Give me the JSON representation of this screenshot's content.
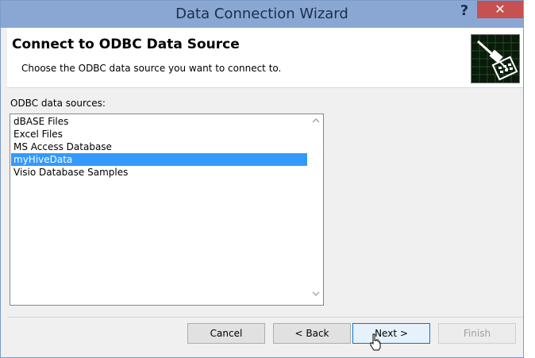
{
  "window": {
    "title": "Data Connection Wizard",
    "help_label": "?",
    "close_label": "✕"
  },
  "header": {
    "title": "Connect to ODBC Data Source",
    "subtitle": "Choose the ODBC data source you want to connect to.",
    "icon": "database-wizard-icon"
  },
  "list": {
    "label": "ODBC data sources:",
    "items": [
      {
        "label": "dBASE Files",
        "selected": false
      },
      {
        "label": "Excel Files",
        "selected": false
      },
      {
        "label": "MS Access Database",
        "selected": false
      },
      {
        "label": "myHiveData",
        "selected": true
      },
      {
        "label": "Visio Database Samples",
        "selected": false
      }
    ],
    "scroll_up_icon": "chevron-up-icon",
    "scroll_down_icon": "chevron-down-icon"
  },
  "buttons": {
    "cancel": "Cancel",
    "back": "< Back",
    "next": "Next >",
    "finish": "Finish"
  },
  "colors": {
    "titlebar": "#8aa7d3",
    "selection": "#3399ff",
    "close": "#c75050"
  }
}
